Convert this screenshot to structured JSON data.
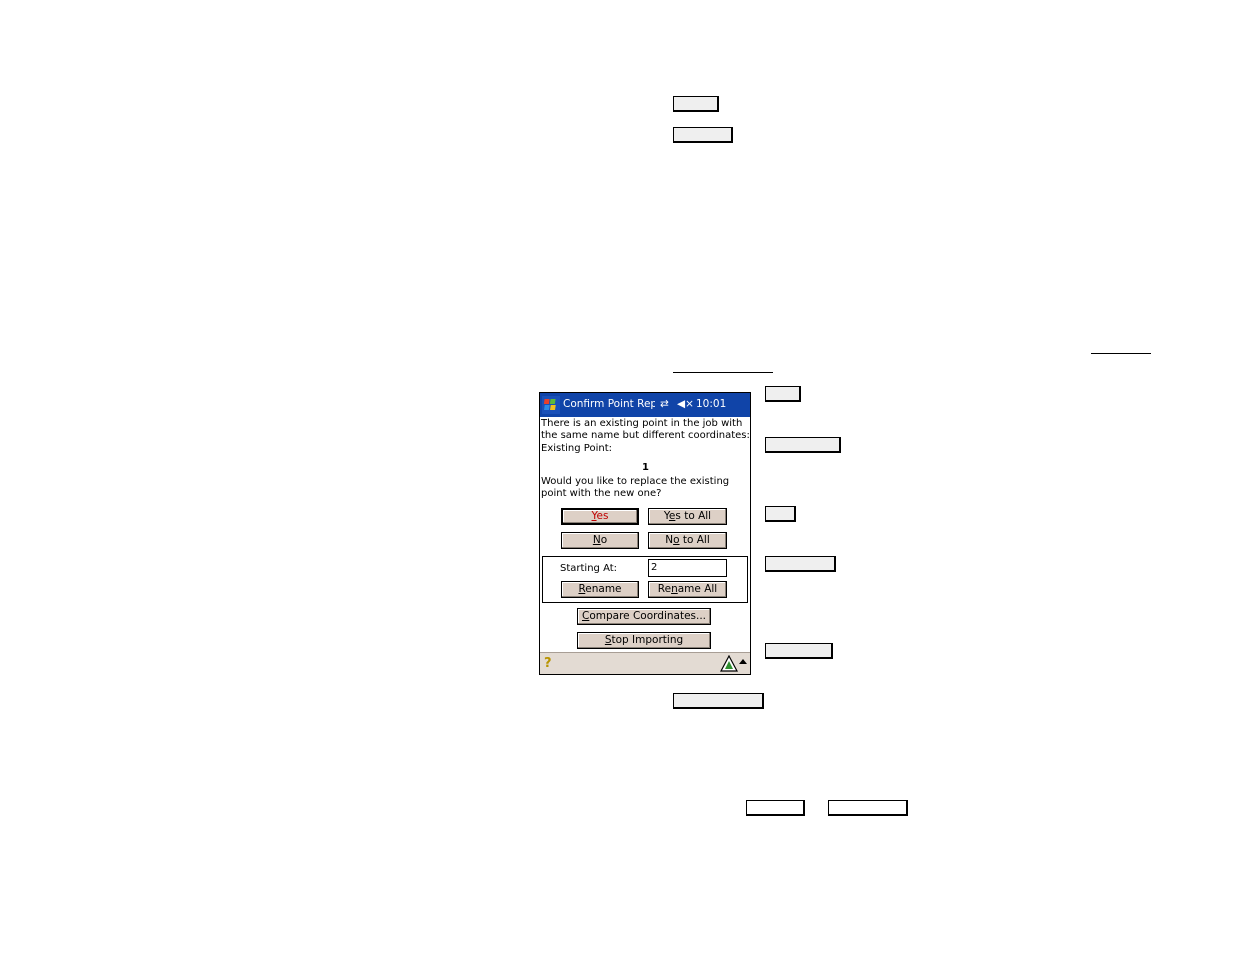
{
  "dialog": {
    "title": "Confirm Point Repl",
    "status_time": "10:01",
    "message_lines": [
      "There is an existing point in the job with",
      "the same name but different coordinates:",
      "Existing Point:"
    ],
    "point_name": "1",
    "question_lines": [
      "Would you like to replace the existing",
      "point with the new one?"
    ],
    "buttons": {
      "yes": {
        "pre": "",
        "key": "Y",
        "post": "es"
      },
      "yes_all": {
        "pre": "Y",
        "key": "e",
        "post": "s to All"
      },
      "no": {
        "pre": "",
        "key": "N",
        "post": "o"
      },
      "no_all": {
        "pre": "N",
        "key": "o",
        "post": " to All"
      },
      "rename": {
        "pre": "",
        "key": "R",
        "post": "ename"
      },
      "rename_all": {
        "pre": "Re",
        "key": "n",
        "post": "ame All"
      },
      "compare": {
        "pre": "",
        "key": "C",
        "post": "ompare Coordinates..."
      },
      "stop": {
        "pre": "",
        "key": "S",
        "post": "top Importing"
      }
    },
    "starting_at_label": "Starting At:",
    "starting_at_value": "2"
  },
  "icons": {
    "start": "windows-flag-icon",
    "connectivity": "sync-arrows-icon",
    "volume": "speaker-muted-icon",
    "help": "help-icon",
    "app": "warning-triangle-icon",
    "up": "up-arrow-icon"
  },
  "colors": {
    "titlebar": "#1044a8",
    "button_face": "#ddd0c6",
    "yes_text": "#c00000"
  }
}
